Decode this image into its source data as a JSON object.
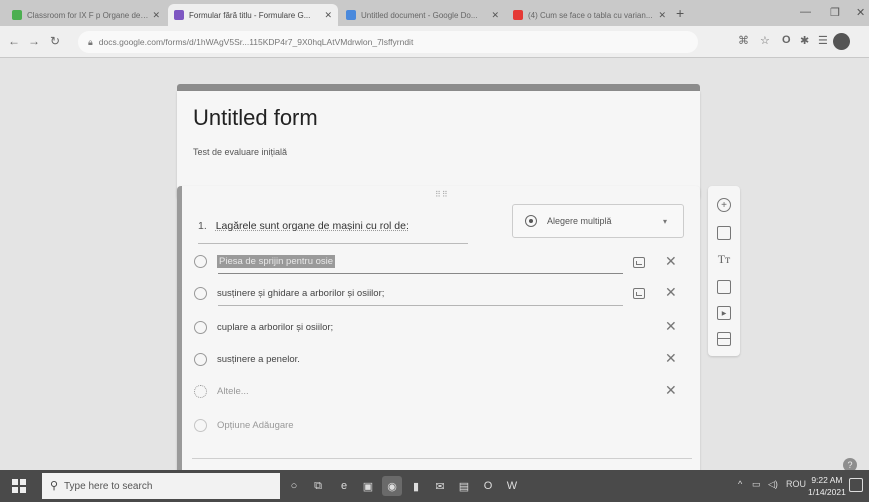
{
  "browser": {
    "tabs": [
      {
        "title": "Classroom for IX F p Organe de ...",
        "active": false,
        "favicon": "#4caf50"
      },
      {
        "title": "Formular fără titlu - Formulare G...",
        "active": true,
        "favicon": "#7e57c2"
      },
      {
        "title": "Untitled document - Google Do...",
        "active": false,
        "favicon": "#4a89dc"
      },
      {
        "title": "(4) Cum se face o tabla cu varian...",
        "active": false,
        "favicon": "#e53935"
      }
    ],
    "url": "docs.google.com/forms/d/1hWAgV5Sr...115KDP4r7_9X0hqLAtVMdrwlon_7lsffyrndit"
  },
  "form": {
    "title": "Untitled form",
    "description": "Test de evaluare inițială",
    "question": {
      "number": "1.",
      "text": "Lagărele sunt organe de mașini cu rol de:",
      "type": "Alegere multiplă",
      "options": [
        "Piesa de sprijin pentru osie",
        "susținere și ghidare a arborilor și osiilor;",
        "cuplare a arborilor și osiilor;",
        "susținere a penelor."
      ],
      "other_label": "Altele...",
      "add_option_label": "Opțiune Adăugare"
    }
  },
  "side_toolbar": {
    "icons": [
      "add-question-icon",
      "import-questions-icon",
      "add-title-icon",
      "add-image-icon",
      "add-video-icon",
      "add-section-icon"
    ],
    "title_glyph": "Tт"
  },
  "taskbar": {
    "search_placeholder": "Type here to search",
    "language": "ROU",
    "time": "9:22 AM",
    "date": "1/14/2021"
  }
}
